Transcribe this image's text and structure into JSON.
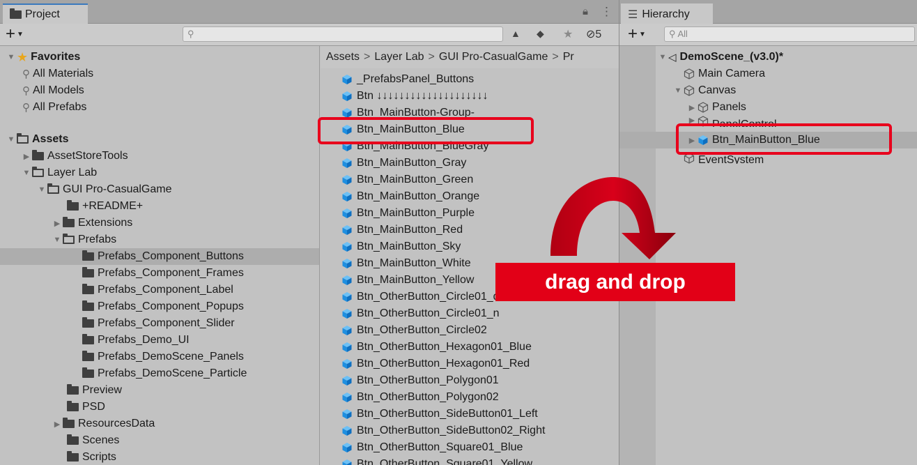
{
  "project": {
    "tab_title": "Project",
    "lock_icon": "lock-icon",
    "menu_icon": "kebab-icon",
    "add_label": "+",
    "search_placeholder": "",
    "hidden_count_label": "5",
    "toolbar_icons": [
      "scene-filter-icon",
      "label-filter-icon",
      "favorite-star-icon",
      "hidden-packages-icon"
    ],
    "tree": [
      {
        "label": "Favorites",
        "type": "favorites",
        "expanded": true
      },
      {
        "label": "All Materials",
        "type": "search"
      },
      {
        "label": "All Models",
        "type": "search"
      },
      {
        "label": "All Prefabs",
        "type": "search"
      },
      {
        "label": "Assets",
        "type": "root",
        "expanded": true
      },
      {
        "label": "AssetStoreTools",
        "type": "folder",
        "collapsed": true
      },
      {
        "label": "Layer Lab",
        "type": "folder",
        "expanded": true
      },
      {
        "label": "GUI Pro-CasualGame",
        "type": "folder",
        "expanded": true
      },
      {
        "label": "+README+",
        "type": "folder"
      },
      {
        "label": "Extensions",
        "type": "folder",
        "collapsed": true
      },
      {
        "label": "Prefabs",
        "type": "folder",
        "expanded": true
      },
      {
        "label": "Prefabs_Component_Buttons",
        "type": "folder",
        "selected": true
      },
      {
        "label": "Prefabs_Component_Frames",
        "type": "folder"
      },
      {
        "label": "Prefabs_Component_Label",
        "type": "folder"
      },
      {
        "label": "Prefabs_Component_Popups",
        "type": "folder"
      },
      {
        "label": "Prefabs_Component_Slider",
        "type": "folder"
      },
      {
        "label": "Prefabs_Demo_UI",
        "type": "folder"
      },
      {
        "label": "Prefabs_DemoScene_Panels",
        "type": "folder"
      },
      {
        "label": "Prefabs_DemoScene_Particle",
        "type": "folder"
      },
      {
        "label": "Preview",
        "type": "folder"
      },
      {
        "label": "PSD",
        "type": "folder"
      },
      {
        "label": "ResourcesData",
        "type": "folder",
        "collapsed": true
      },
      {
        "label": "Scenes",
        "type": "folder"
      },
      {
        "label": "Scripts",
        "type": "folder"
      }
    ],
    "breadcrumb": [
      "Assets",
      "Layer Lab",
      "GUI Pro-CasualGame",
      "Pr"
    ],
    "assets": [
      "_PrefabsPanel_Buttons",
      "Btn ↓↓↓↓↓↓↓↓↓↓↓↓↓↓↓↓↓↓↓↓",
      "Btn_MainButton-Group-",
      "Btn_MainButton_Blue",
      "Btn_MainButton_BlueGray",
      "Btn_MainButton_Gray",
      "Btn_MainButton_Green",
      "Btn_MainButton_Orange",
      "Btn_MainButton_Purple",
      "Btn_MainButton_Red",
      "Btn_MainButton_Sky",
      "Btn_MainButton_White",
      "Btn_MainButton_Yellow",
      "Btn_OtherButton_Circle01_d",
      "Btn_OtherButton_Circle01_n",
      "Btn_OtherButton_Circle02",
      "Btn_OtherButton_Hexagon01_Blue",
      "Btn_OtherButton_Hexagon01_Red",
      "Btn_OtherButton_Polygon01",
      "Btn_OtherButton_Polygon02",
      "Btn_OtherButton_SideButton01_Left",
      "Btn_OtherButton_SideButton02_Right",
      "Btn_OtherButton_Square01_Blue",
      "Btn_OtherButton_Square01_Yellow"
    ]
  },
  "hierarchy": {
    "tab_title": "Hierarchy",
    "menu_icon": "list-icon",
    "add_label": "+",
    "search_placeholder": "All",
    "items": [
      {
        "label": "DemoScene_(v3.0)*",
        "type": "scene",
        "bold": true
      },
      {
        "label": "Main Camera",
        "type": "gameobject"
      },
      {
        "label": "Canvas",
        "type": "gameobject"
      },
      {
        "label": "Panels",
        "type": "gameobject"
      },
      {
        "label": "PanelControl",
        "type": "gameobject"
      },
      {
        "label": "Btn_MainButton_Blue",
        "type": "prefab",
        "selected": true
      },
      {
        "label": "EventSystem",
        "type": "gameobject"
      }
    ]
  },
  "annotation": {
    "label": "drag and drop",
    "color": "#e20017"
  },
  "colors": {
    "prefab_blue": "#1f8fe0",
    "highlight_red": "#e8001c",
    "tab_accent": "#3a79bd"
  }
}
